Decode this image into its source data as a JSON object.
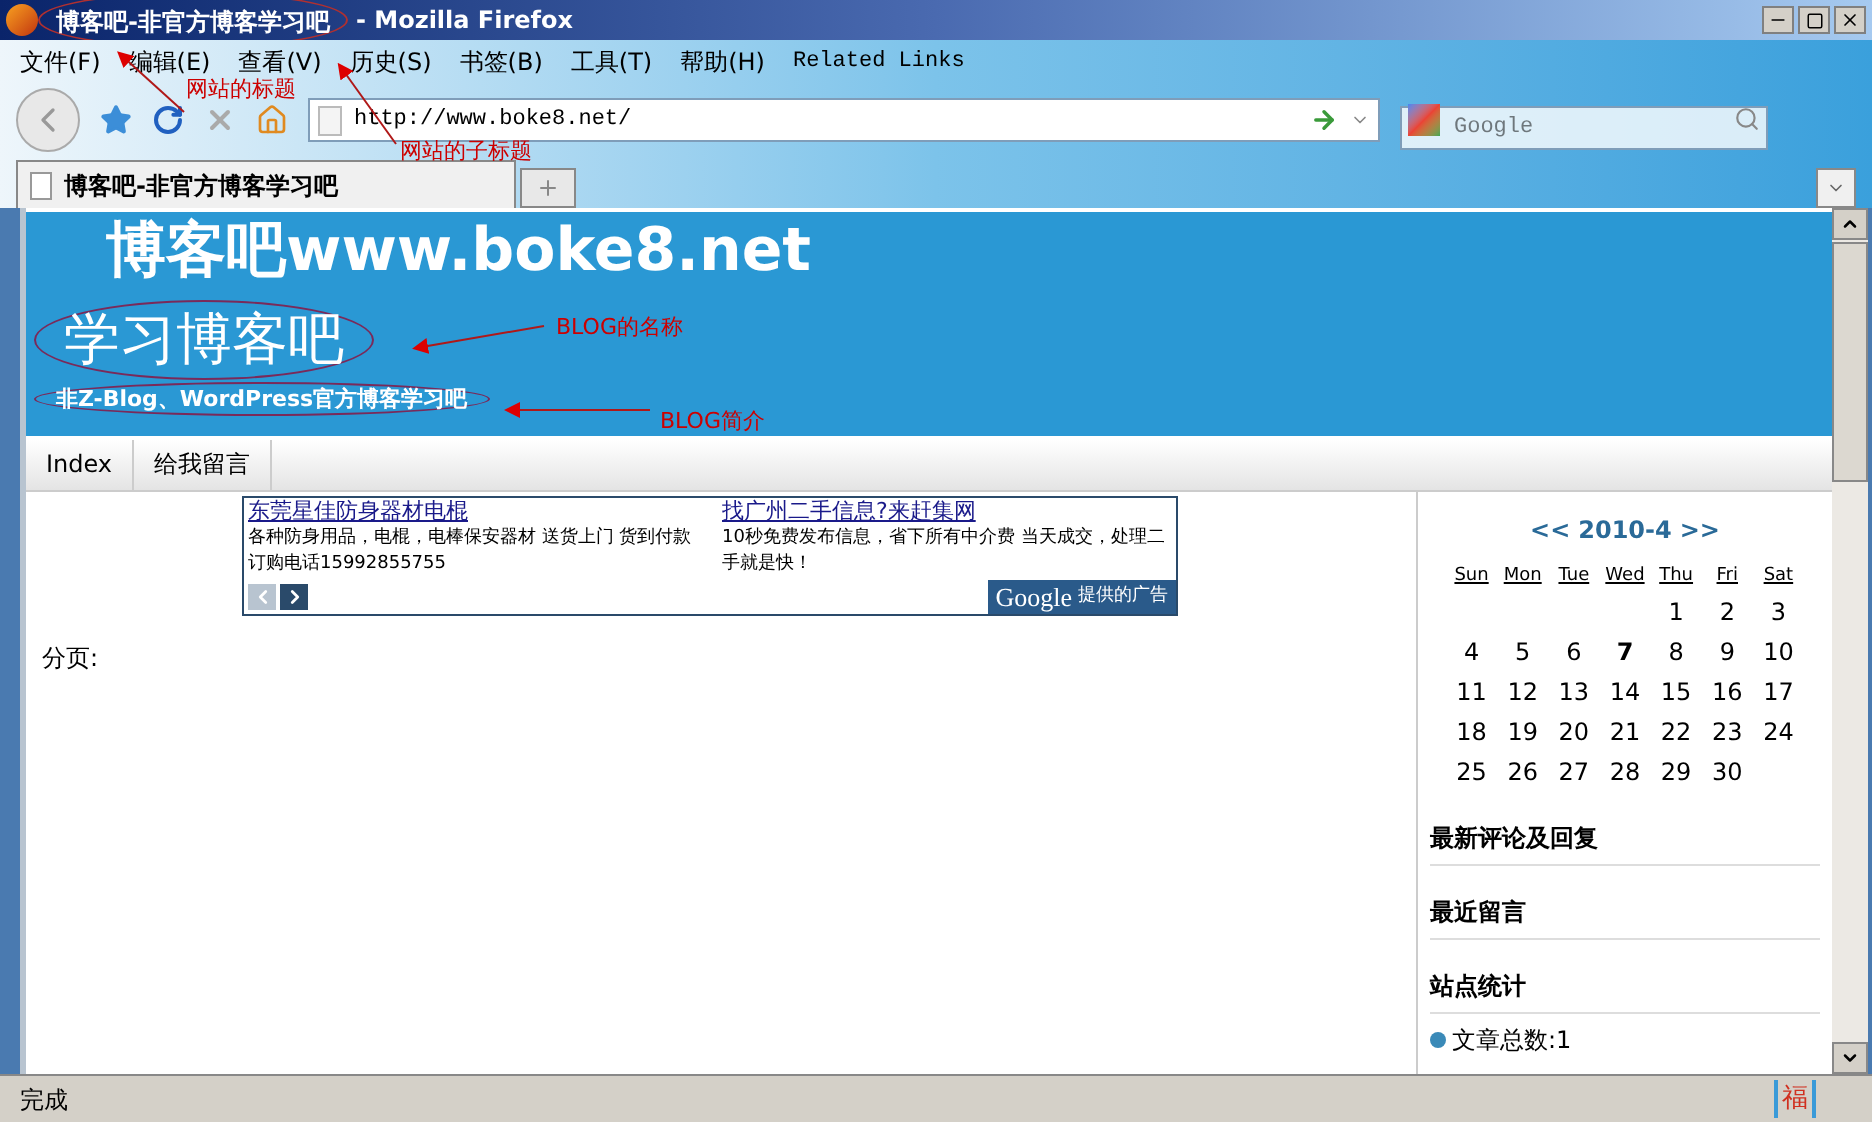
{
  "window": {
    "page_title": "博客吧-非官方博客学习吧",
    "app_name": "- Mozilla Firefox"
  },
  "menu": [
    "文件(F)",
    "编辑(E)",
    "查看(V)",
    "历史(S)",
    "书签(B)",
    "工具(T)",
    "帮助(H)",
    "Related Links"
  ],
  "address_bar": {
    "value": "http://www.boke8.net/"
  },
  "search": {
    "placeholder": "Google"
  },
  "tabs": [
    {
      "label": "博客吧-非官方博客学习吧",
      "selected": true
    }
  ],
  "page": {
    "logo": "博客吧www.boke8.net",
    "blog_name": "学习博客吧",
    "blog_description": "非Z-Blog、WordPress官方博客学习吧",
    "nav": [
      "Index",
      "给我留言"
    ],
    "ads": [
      {
        "title": "东莞星佳防身器材电棍",
        "text": "各种防身用品，电棍，电棒保安器材 送货上门 货到付款订购电话15992855755"
      },
      {
        "title": "找广州二手信息?来赶集网",
        "text": "10秒免费发布信息，省下所有中介费 当天成交，处理二手就是快！"
      }
    ],
    "ad_badge": {
      "brand": "Google",
      "label": "提供的广告"
    },
    "pagination_label": "分页:"
  },
  "calendar": {
    "prev": "<<",
    "month": "2010-4",
    "next": ">>",
    "weekdays": [
      "Sun",
      "Mon",
      "Tue",
      "Wed",
      "Thu",
      "Fri",
      "Sat"
    ],
    "days": [
      {
        "day": "1",
        "today": false
      },
      {
        "day": "2",
        "today": false
      },
      {
        "day": "3",
        "today": false
      },
      {
        "day": "4",
        "today": false
      },
      {
        "day": "5",
        "today": false
      },
      {
        "day": "6",
        "today": false
      },
      {
        "day": "7",
        "today": true
      },
      {
        "day": "8",
        "today": false
      },
      {
        "day": "9",
        "today": false
      },
      {
        "day": "10",
        "today": false
      },
      {
        "day": "11",
        "today": false
      },
      {
        "day": "12",
        "today": false
      },
      {
        "day": "13",
        "today": false
      },
      {
        "day": "14",
        "today": false
      },
      {
        "day": "15",
        "today": false
      },
      {
        "day": "16",
        "today": false
      },
      {
        "day": "17",
        "today": false
      },
      {
        "day": "18",
        "today": false
      },
      {
        "day": "19",
        "today": false
      },
      {
        "day": "20",
        "today": false
      },
      {
        "day": "21",
        "today": false
      },
      {
        "day": "22",
        "today": false
      },
      {
        "day": "23",
        "today": false
      },
      {
        "day": "24",
        "today": false
      },
      {
        "day": "25",
        "today": false
      },
      {
        "day": "26",
        "today": false
      },
      {
        "day": "27",
        "today": false
      },
      {
        "day": "28",
        "today": false
      },
      {
        "day": "29",
        "today": false
      },
      {
        "day": "30",
        "today": false
      }
    ]
  },
  "sidebar_sections": [
    {
      "title": "最新评论及回复"
    },
    {
      "title": "最近留言"
    },
    {
      "title": "站点统计",
      "items": [
        "文章总数:1"
      ]
    }
  ],
  "annotations": [
    "网站的标题",
    "网站的子标题",
    "BLOG的名称",
    "BLOG简介"
  ],
  "status_bar": {
    "text": "完成",
    "addon_icon": "福"
  }
}
